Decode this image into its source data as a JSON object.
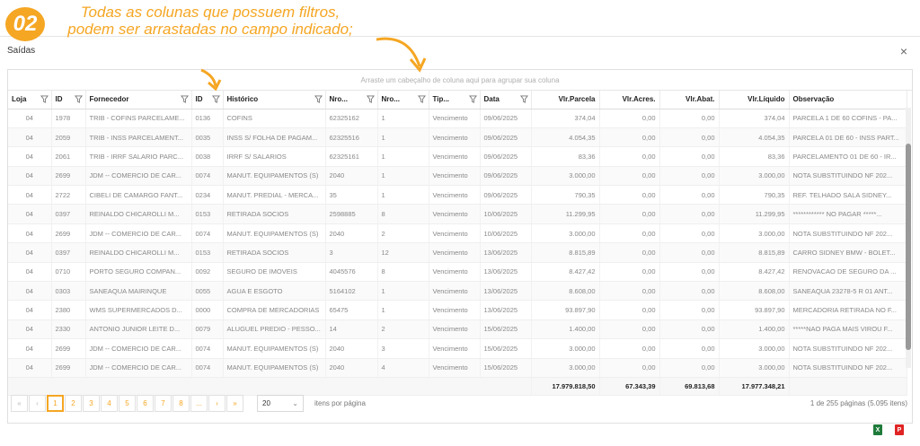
{
  "annotation": {
    "step": "02",
    "line1": "Todas as colunas que possuem filtros,",
    "line2": "podem ser arrastadas no campo indicado;"
  },
  "dialog": {
    "title": "Saídas",
    "close": "×"
  },
  "group_panel": "Arraste um cabeçalho de coluna aqui para agrupar sua coluna",
  "columns": [
    {
      "label": "Loja",
      "filter": true
    },
    {
      "label": "ID",
      "filter": true
    },
    {
      "label": "Fornecedor",
      "filter": true
    },
    {
      "label": "ID",
      "filter": true
    },
    {
      "label": "Histórico",
      "filter": true
    },
    {
      "label": "Nro...",
      "filter": true
    },
    {
      "label": "Nro...",
      "filter": true
    },
    {
      "label": "Tip...",
      "filter": true
    },
    {
      "label": "Data",
      "filter": true
    },
    {
      "label": "Vlr.Parcela",
      "filter": false
    },
    {
      "label": "Vlr.Acres.",
      "filter": false
    },
    {
      "label": "Vlr.Abat.",
      "filter": false
    },
    {
      "label": "Vlr.Líquido",
      "filter": false
    },
    {
      "label": "Observação",
      "filter": false
    }
  ],
  "rows": [
    [
      "04",
      "1978",
      "TRIB - COFINS PARCELAME...",
      "0136",
      "COFINS",
      "62325162",
      "1",
      "Vencimento",
      "09/06/2025",
      "374,04",
      "0,00",
      "0,00",
      "374,04",
      "PARCELA 1 DE 60 COFINS - PA..."
    ],
    [
      "04",
      "2059",
      "TRIB - INSS PARCELAMENT...",
      "0035",
      "INSS S/ FOLHA DE PAGAM...",
      "62325516",
      "1",
      "Vencimento",
      "09/06/2025",
      "4.054,35",
      "0,00",
      "0,00",
      "4.054,35",
      "PARCELA 01 DE 60 - INSS PART..."
    ],
    [
      "04",
      "2061",
      "TRIB - IRRF SALARIO PARC...",
      "0038",
      "IRRF S/ SALARIOS",
      "62325161",
      "1",
      "Vencimento",
      "09/06/2025",
      "83,36",
      "0,00",
      "0,00",
      "83,36",
      "PARCELAMENTO 01 DE 60 - IR..."
    ],
    [
      "04",
      "2699",
      "JDM -- COMERCIO DE CAR...",
      "0074",
      "MANUT. EQUIPAMENTOS (S)",
      "2040",
      "1",
      "Vencimento",
      "09/06/2025",
      "3.000,00",
      "0,00",
      "0,00",
      "3.000,00",
      "NOTA SUBSTITUINDO NF 202..."
    ],
    [
      "04",
      "2722",
      "CIBELI DE CAMARGO FANT...",
      "0234",
      "MANUT. PREDIAL - MERCA...",
      "35",
      "1",
      "Vencimento",
      "09/06/2025",
      "790,35",
      "0,00",
      "0,00",
      "790,35",
      "REF. TELHADO SALA SIDNEY..."
    ],
    [
      "04",
      "0397",
      "REINALDO CHICAROLLI M...",
      "0153",
      "RETIRADA SOCIOS",
      "2598885",
      "8",
      "Vencimento",
      "10/06/2025",
      "11.299,95",
      "0,00",
      "0,00",
      "11.299,95",
      "************ NO PAGAR *****..."
    ],
    [
      "04",
      "2699",
      "JDM -- COMERCIO DE CAR...",
      "0074",
      "MANUT. EQUIPAMENTOS (S)",
      "2040",
      "2",
      "Vencimento",
      "10/06/2025",
      "3.000,00",
      "0,00",
      "0,00",
      "3.000,00",
      "NOTA SUBSTITUINDO NF 202..."
    ],
    [
      "04",
      "0397",
      "REINALDO CHICAROLLI M...",
      "0153",
      "RETIRADA SOCIOS",
      "3",
      "12",
      "Vencimento",
      "13/06/2025",
      "8.815,89",
      "0,00",
      "0,00",
      "8.815,89",
      "CARRO SIDNEY BMW - BOLET..."
    ],
    [
      "04",
      "0710",
      "PORTO SEGURO COMPAN...",
      "0092",
      "SEGURO DE IMOVEIS",
      "4045576",
      "8",
      "Vencimento",
      "13/06/2025",
      "8.427,42",
      "0,00",
      "0,00",
      "8.427,42",
      "RENOVACAO DE SEGURO DA ..."
    ],
    [
      "04",
      "0303",
      "SANEAQUA MAIRINQUE",
      "0055",
      "AGUA E ESGOTO",
      "5164102",
      "1",
      "Vencimento",
      "13/06/2025",
      "8.608,00",
      "0,00",
      "0,00",
      "8.608,00",
      "SANEAQUA 23278-5 R 01 ANT..."
    ],
    [
      "04",
      "2380",
      "WMS SUPERMERCADOS D...",
      "0000",
      "COMPRA DE MERCADORIAS",
      "65475",
      "1",
      "Vencimento",
      "13/06/2025",
      "93.897,90",
      "0,00",
      "0,00",
      "93.897,90",
      "MERCADORIA RETIRADA NO F..."
    ],
    [
      "04",
      "2330",
      "ANTONIO JUNIOR LEITE D...",
      "0079",
      "ALUGUEL PREDIO - PESSO...",
      "14",
      "2",
      "Vencimento",
      "15/06/2025",
      "1.400,00",
      "0,00",
      "0,00",
      "1.400,00",
      "*****NAO PAGA MAIS VIROU F..."
    ],
    [
      "04",
      "2699",
      "JDM -- COMERCIO DE CAR...",
      "0074",
      "MANUT. EQUIPAMENTOS (S)",
      "2040",
      "3",
      "Vencimento",
      "15/06/2025",
      "3.000,00",
      "0,00",
      "0,00",
      "3.000,00",
      "NOTA SUBSTITUINDO NF 202..."
    ],
    [
      "04",
      "2699",
      "JDM -- COMERCIO DE CAR...",
      "0074",
      "MANUT. EQUIPAMENTOS (S)",
      "2040",
      "4",
      "Vencimento",
      "15/06/2025",
      "3.000,00",
      "0,00",
      "0,00",
      "3.000,00",
      "NOTA SUBSTITUINDO NF 202..."
    ]
  ],
  "totals": {
    "parcela": "17.979.818,50",
    "acres": "67.343,39",
    "abat": "69.813,68",
    "liquido": "17.977.348,21"
  },
  "pager": {
    "first": "«",
    "prev": "‹",
    "pages": [
      "1",
      "2",
      "3",
      "4",
      "5",
      "6",
      "7",
      "8",
      "..."
    ],
    "next": "›",
    "last": "»",
    "active_page": "1",
    "page_size": "20",
    "per_page_label": "itens por página",
    "info": "1 de 255 páginas (5.095 itens)"
  },
  "colors": {
    "accent": "#f5a623",
    "excel": "#1e7b3a",
    "pdf": "#e02424"
  }
}
